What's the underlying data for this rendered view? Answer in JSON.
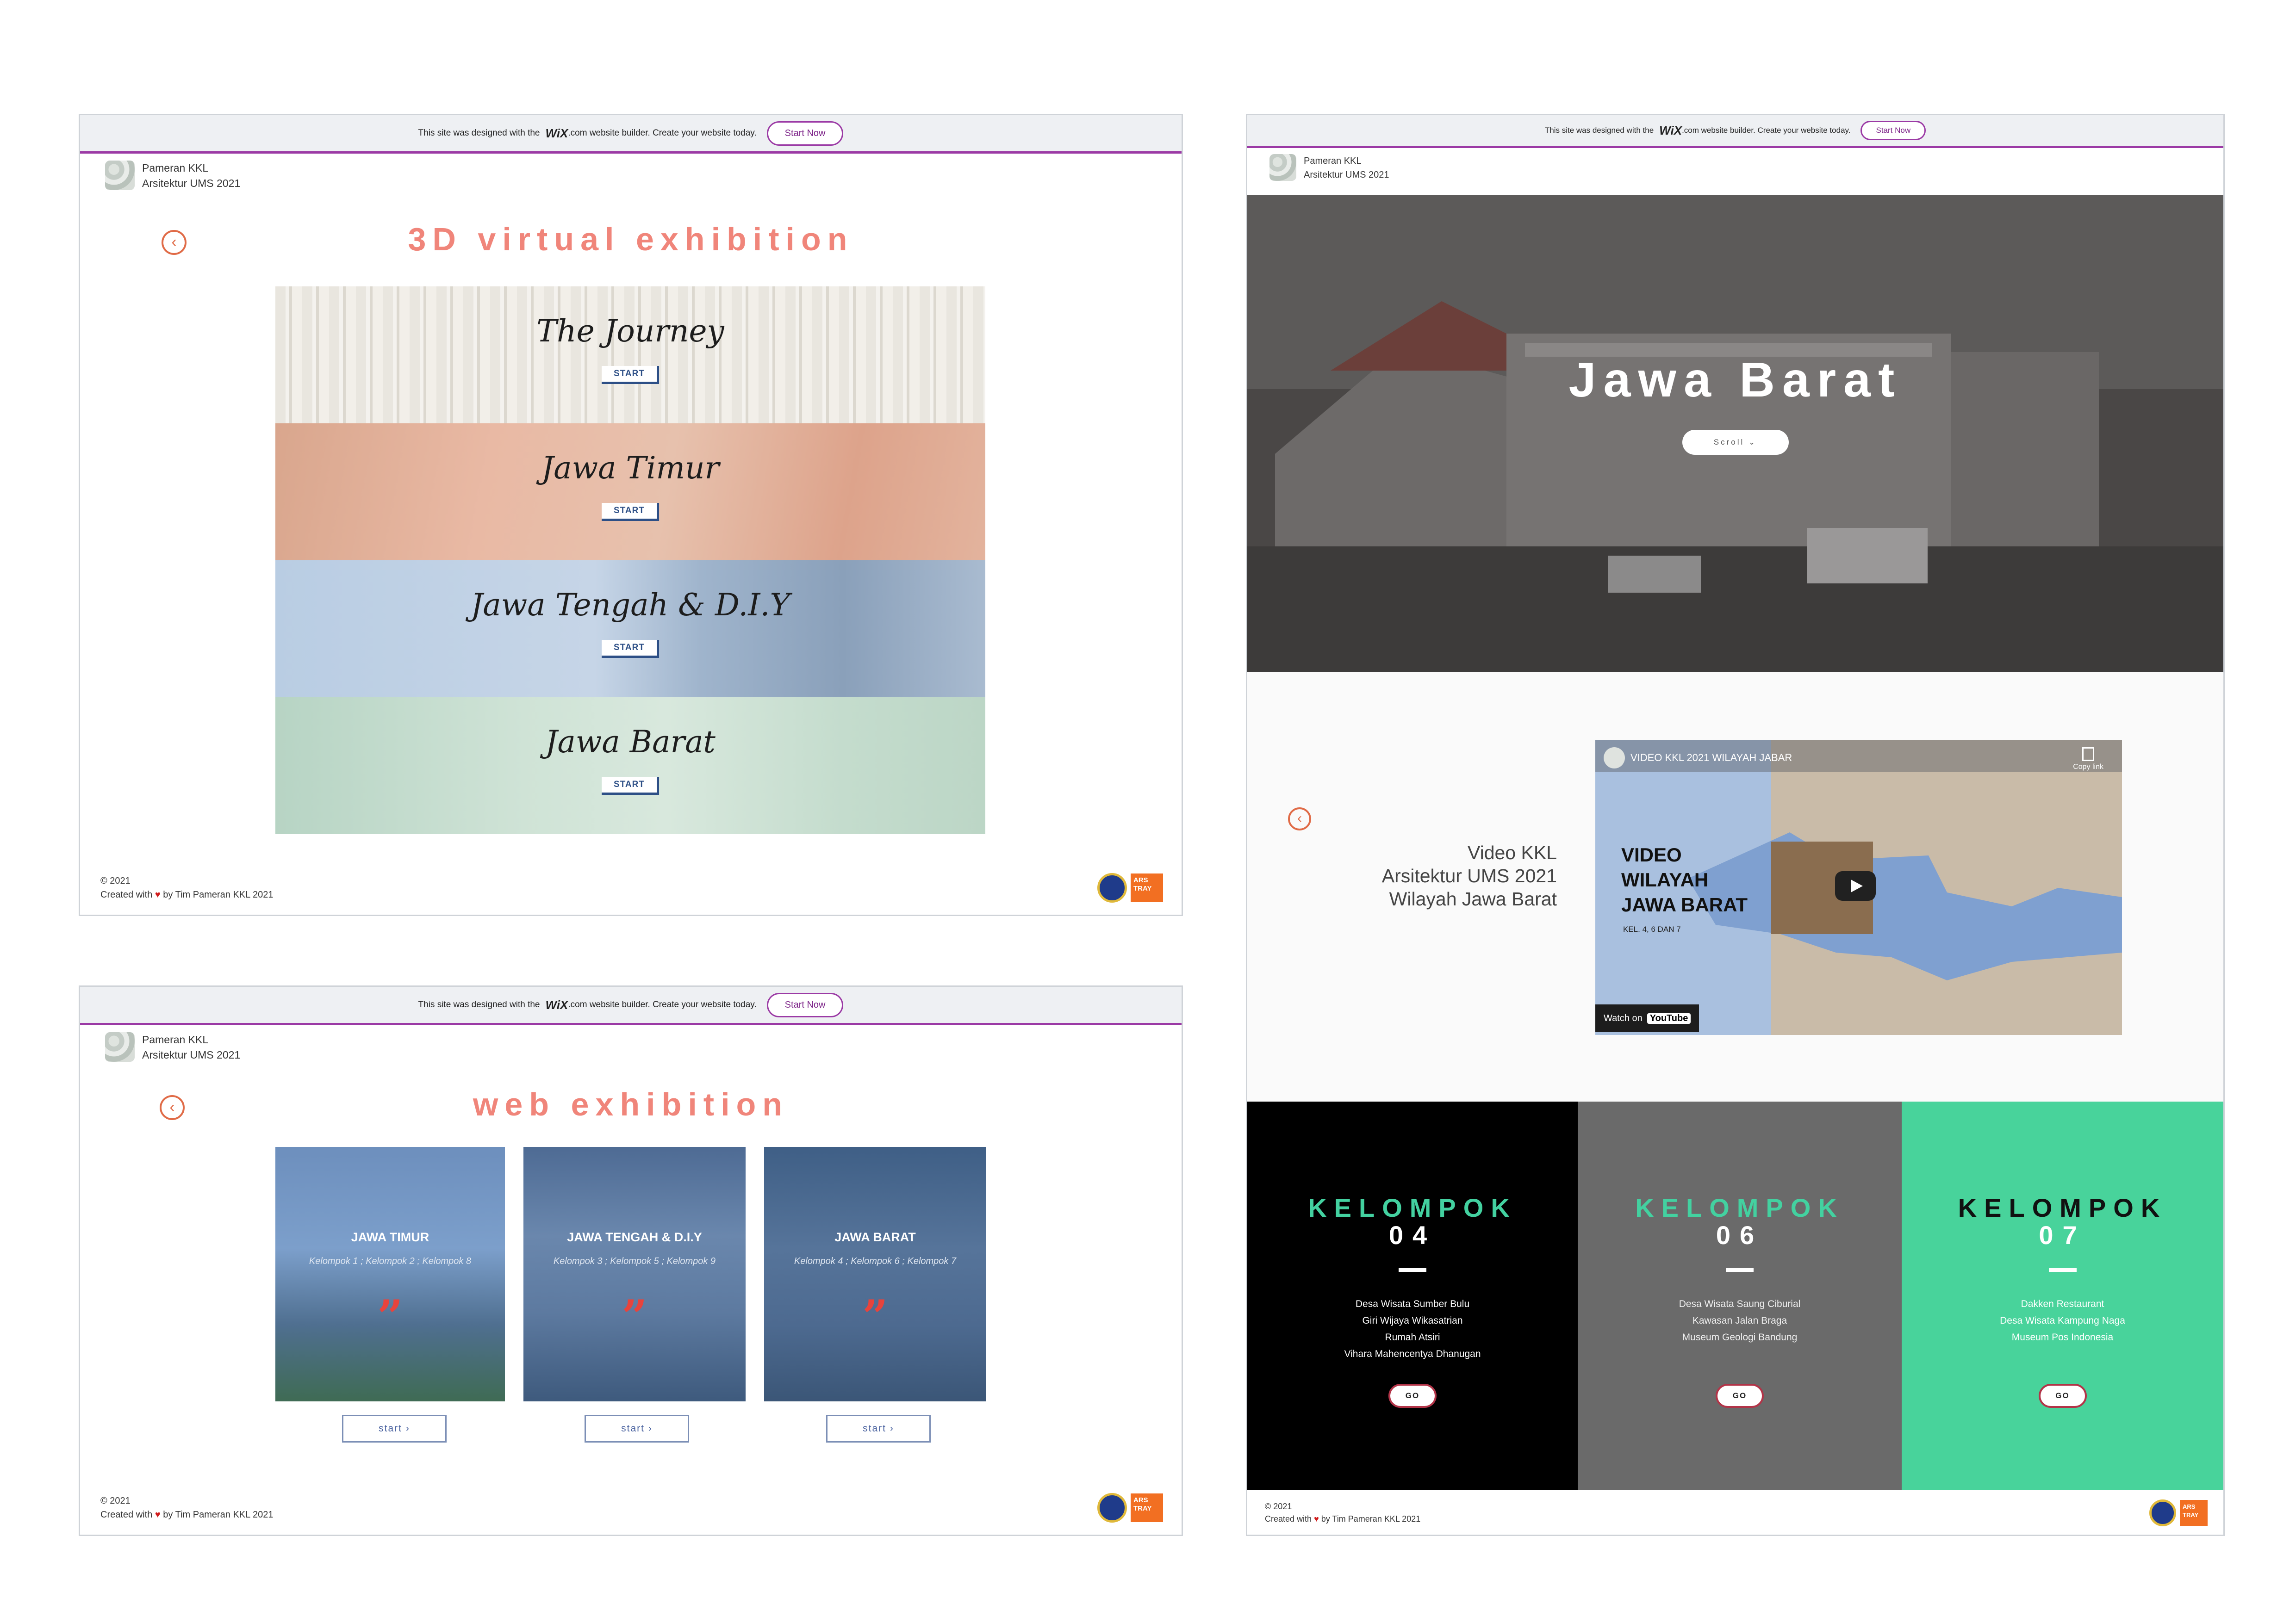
{
  "wixbar": {
    "text_before": "This site was designed with the",
    "brand": "WiX",
    "text_after": ".com website builder. Create your website today.",
    "start_now": "Start Now"
  },
  "site": {
    "name_line1": "Pameran KKL",
    "name_line2": "Arsitektur UMS 2021"
  },
  "footer": {
    "year": "© 2021",
    "created_prefix": "Created with",
    "heart": "♥",
    "created_suffix": "by Tim Pameran KKL 2021",
    "badge_text": "ARS TRAY"
  },
  "virtual": {
    "back_icon": "‹",
    "title": "3D virtual exhibition",
    "start_label": "START",
    "items": [
      "The Journey",
      "Jawa Timur",
      "Jawa Tengah & D.I.Y",
      "Jawa Barat"
    ]
  },
  "web": {
    "back_icon": "‹",
    "title": "web exhibition",
    "quote": "”",
    "button": "start ›",
    "cards": [
      {
        "title": "JAWA TIMUR",
        "sub": "Kelompok 1 ; Kelompok 2 ; Kelompok 8"
      },
      {
        "title": "JAWA TENGAH & D.I.Y",
        "sub": "Kelompok 3 ; Kelompok 5 ; Kelompok 9"
      },
      {
        "title": "JAWA BARAT",
        "sub": "Kelompok 4 ; Kelompok 6 ; Kelompok 7"
      }
    ]
  },
  "barat": {
    "hero_title": "Jawa Barat",
    "scroll_label": "Scroll ⌄",
    "back_icon": "‹",
    "video_text": [
      "Video KKL",
      "Arsitektur UMS 2021",
      "Wilayah Jawa Barat"
    ],
    "video": {
      "channel_title": "VIDEO KKL 2021 WILAYAH JABAR",
      "copy_link": "Copy link",
      "big_text": [
        "VIDEO",
        "WILAYAH",
        "JAWA BARAT"
      ],
      "small_text": "KEL. 4, 6 DAN 7",
      "watch_on": "Watch on",
      "youtube": "YouTube"
    },
    "kelompok_label": "KELOMPOK",
    "go_label": "GO",
    "groups": [
      {
        "num": "04",
        "items": [
          "Desa Wisata Sumber Bulu",
          "Giri Wijaya Wikasatrian",
          "Rumah Atsiri",
          "Vihara Mahencentya Dhanugan"
        ]
      },
      {
        "num": "06",
        "items": [
          "Desa Wisata Saung Ciburial",
          "Kawasan Jalan Braga",
          "Museum Geologi Bandung"
        ]
      },
      {
        "num": "07",
        "items": [
          "Dakken Restaurant",
          "Desa Wisata Kampung Naga",
          "Museum Pos Indonesia"
        ]
      }
    ]
  }
}
